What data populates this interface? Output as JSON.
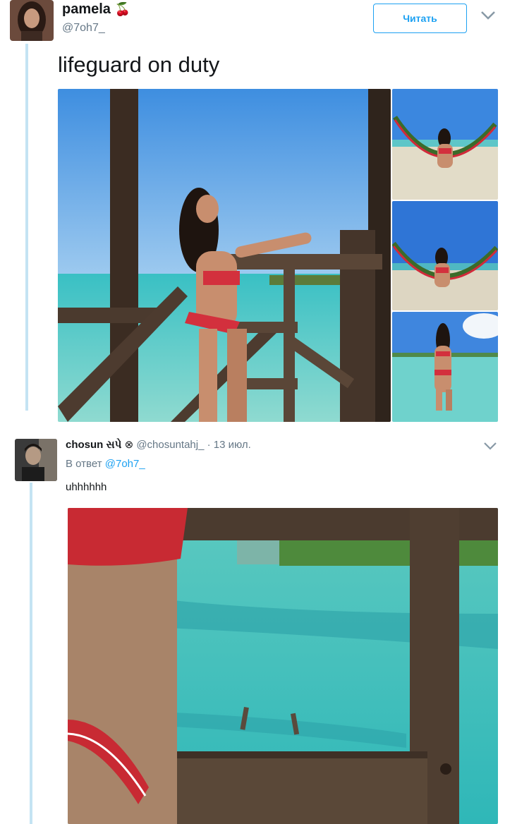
{
  "tweet": {
    "author_name": "pamela",
    "author_emoji": "🍒",
    "author_handle": "@7oh7_",
    "follow_label": "Читать",
    "text": "lifeguard on duty",
    "photo_count": 4
  },
  "reply": {
    "author_name": "chosun સપે",
    "verified_glyph": "⊗",
    "author_handle": "@chosuntahj_",
    "date": "· 13 июл.",
    "reply_to_prefix": "В ответ",
    "reply_to_handle": "@7oh7_",
    "text": "uhhhhhh"
  },
  "colors": {
    "accent": "#1da1f2",
    "thread_line": "#c4e3f3",
    "muted": "#657786"
  },
  "icons": [
    "cherry-icon",
    "chevron-down-icon",
    "verified-icon"
  ]
}
